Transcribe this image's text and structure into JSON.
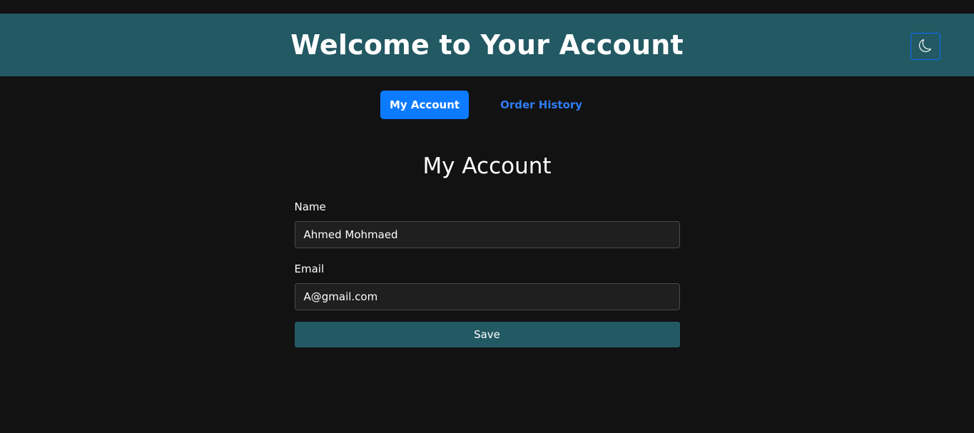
{
  "header": {
    "title": "Welcome to Your Account",
    "theme_toggle_icon": "moon-icon"
  },
  "tabs": [
    {
      "label": "My Account",
      "active": true
    },
    {
      "label": "Order History",
      "active": false
    }
  ],
  "main": {
    "title": "My Account",
    "fields": {
      "name": {
        "label": "Name",
        "value": "Ahmed Mohmaed"
      },
      "email": {
        "label": "Email",
        "value": "A@gmail.com"
      }
    },
    "save_label": "Save"
  },
  "colors": {
    "background": "#121212",
    "header": "#225963",
    "accent": "#0d7bff",
    "link": "#2f7cf6"
  }
}
